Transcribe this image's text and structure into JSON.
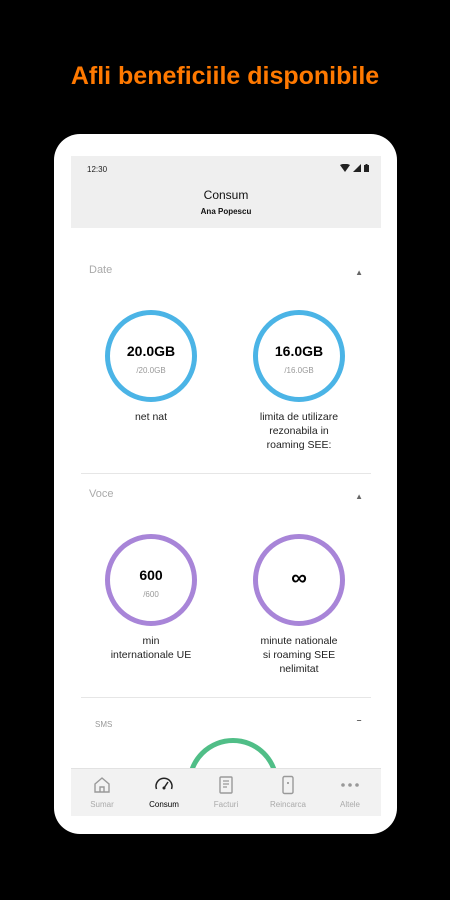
{
  "promo": {
    "headline": "Afli beneficiile disponibile"
  },
  "status_bar": {
    "time": "12:30",
    "icons": [
      "wifi-icon",
      "signal-icon",
      "battery-icon"
    ]
  },
  "header": {
    "title": "Consum",
    "subtitle": "Ana Popescu"
  },
  "sections": {
    "date": {
      "title": "Date",
      "items": [
        {
          "value": "20.0GB",
          "total": "/20.0GB",
          "label_lines": [
            "net nat"
          ],
          "ring_color": "#4bb4e6"
        },
        {
          "value": "16.0GB",
          "total": "/16.0GB",
          "label_lines": [
            "limita de utilizare",
            "rezonabila in",
            "roaming SEE:"
          ],
          "ring_color": "#4bb4e6"
        }
      ]
    },
    "voce": {
      "title": "Voce",
      "items": [
        {
          "value": "600",
          "total": "/600",
          "label_lines": [
            "min",
            "internationale UE"
          ],
          "ring_color": "#a885d8"
        },
        {
          "value": "∞",
          "label_lines": [
            "minute nationale",
            "si roaming SEE",
            "nelimitat"
          ],
          "ring_color": "#a885d8"
        }
      ]
    },
    "sms": {
      "title": "SMS",
      "ring_color": "#50be87"
    }
  },
  "bottom_nav": [
    {
      "label": "Sumar",
      "icon": "home-icon",
      "active": false
    },
    {
      "label": "Consum",
      "icon": "speedometer-icon",
      "active": true
    },
    {
      "label": "Facturi",
      "icon": "invoice-icon",
      "active": false
    },
    {
      "label": "Reincarca",
      "icon": "phone-recharge-icon",
      "active": false
    },
    {
      "label": "Altele",
      "icon": "more-icon",
      "active": false
    }
  ]
}
